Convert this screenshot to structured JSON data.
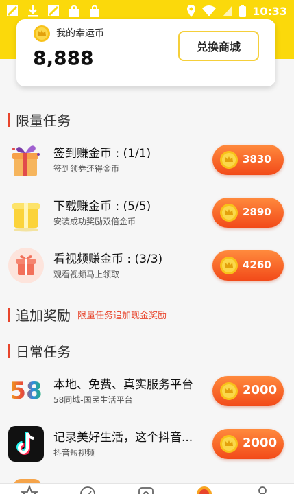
{
  "status_bar": {
    "time": "10:33"
  },
  "coins": {
    "label": "我的幸运币",
    "value": "8,888",
    "exchange_button": "兑换商城"
  },
  "limited": {
    "title": "限量任务",
    "tasks": [
      {
        "title": "签到赚金币 : (1/1)",
        "subtitle": "签到领券还得金币",
        "reward": "3830",
        "icon": "gift-box-icon"
      },
      {
        "title": "下载赚金币 : (5/5)",
        "subtitle": "安装成功奖励双倍金币",
        "reward": "2890",
        "icon": "yellow-gift-icon"
      },
      {
        "title": "看视频赚金币 : (3/3)",
        "subtitle": "观看视频马上领取",
        "reward": "4260",
        "icon": "red-gift-icon"
      }
    ]
  },
  "bonus": {
    "title": "追加奖励",
    "subtitle": "限量任务追加现金奖励"
  },
  "daily": {
    "title": "日常任务",
    "tasks": [
      {
        "title": "本地、免费、真实服务平台",
        "subtitle": "58同城-国民生活平台",
        "reward": "2000",
        "icon": "58-logo-icon",
        "logo_text": "58"
      },
      {
        "title": "记录美好生活，这个抖音...",
        "subtitle": "抖音短视频",
        "reward": "2000",
        "icon": "tiktok-logo-icon"
      }
    ]
  },
  "colors": {
    "brand_yellow": "#fbd90b",
    "accent_red": "#e8452c",
    "button_orange": "#f24a19"
  },
  "bottom_nav": [
    "star-icon",
    "compass-icon",
    "store-icon",
    "coin-tab-icon",
    "profile-icon"
  ]
}
